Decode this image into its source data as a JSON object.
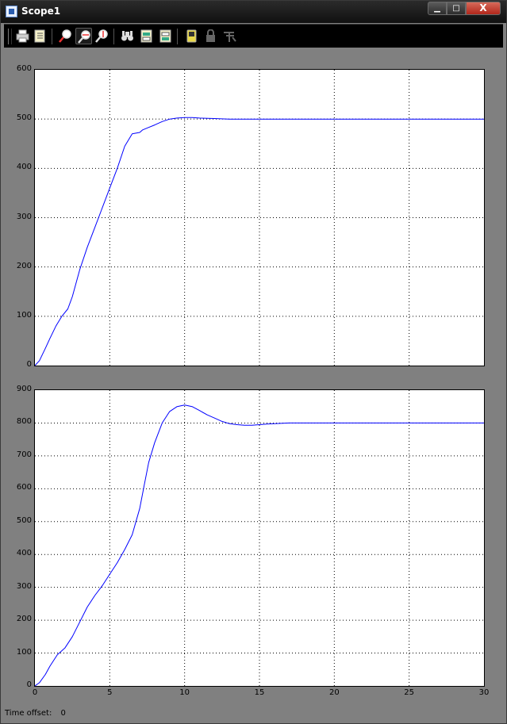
{
  "window": {
    "title": "Scope1",
    "min_label": "▁",
    "max_label": "□",
    "close_label": "X"
  },
  "toolbar": {
    "buttons": [
      {
        "name": "print-icon",
        "active": false
      },
      {
        "name": "parameters-icon",
        "active": false
      },
      {
        "name": "zoom-icon",
        "active": false
      },
      {
        "name": "zoom-x-icon",
        "active": true
      },
      {
        "name": "zoom-y-icon",
        "active": false
      },
      {
        "name": "autoscale-icon",
        "active": false
      },
      {
        "name": "save-axes-settings-icon",
        "active": false
      },
      {
        "name": "restore-axes-settings-icon",
        "active": false
      },
      {
        "name": "floating-scope-icon",
        "active": false
      },
      {
        "name": "lock-axes-icon",
        "active": false
      },
      {
        "name": "signal-selection-icon",
        "active": false
      }
    ]
  },
  "status": {
    "label": "Time offset:",
    "value": "0"
  },
  "chart_data": [
    {
      "type": "line",
      "title": "",
      "xlabel": "",
      "ylabel": "",
      "xlim": [
        0,
        30
      ],
      "ylim": [
        0,
        600
      ],
      "xticks": [
        0,
        5,
        10,
        15,
        20,
        25,
        30
      ],
      "yticks": [
        0,
        100,
        200,
        300,
        400,
        500,
        600
      ],
      "grid": true,
      "series": [
        {
          "color": "#0000ff",
          "x": [
            0,
            0.3,
            0.7,
            1.0,
            1.4,
            1.8,
            2.2,
            2.5,
            3.0,
            3.5,
            4.0,
            4.5,
            5.0,
            5.5,
            6.0,
            6.5,
            7.0,
            7.2,
            7.5,
            8.0,
            8.5,
            9.0,
            9.5,
            10.0,
            10.5,
            11.0,
            12.0,
            13.0,
            30
          ],
          "y": [
            0,
            10,
            35,
            55,
            80,
            100,
            115,
            140,
            195,
            240,
            280,
            320,
            360,
            400,
            445,
            470,
            473,
            478,
            482,
            488,
            495,
            500,
            502,
            503,
            503,
            502,
            501,
            500,
            500
          ]
        }
      ]
    },
    {
      "type": "line",
      "title": "",
      "xlabel": "",
      "ylabel": "",
      "xlim": [
        0,
        30
      ],
      "ylim": [
        0,
        900
      ],
      "xticks": [
        0,
        5,
        10,
        15,
        20,
        25,
        30
      ],
      "yticks": [
        0,
        100,
        200,
        300,
        400,
        500,
        600,
        700,
        800,
        900
      ],
      "grid": true,
      "series": [
        {
          "color": "#0000ff",
          "x": [
            0,
            0.3,
            0.7,
            1.0,
            1.5,
            2.0,
            2.5,
            3.0,
            3.5,
            4.0,
            4.5,
            5.0,
            5.5,
            6.0,
            6.5,
            7.0,
            7.3,
            7.6,
            8.0,
            8.5,
            9.0,
            9.5,
            10.0,
            10.5,
            11.0,
            11.5,
            12.0,
            12.5,
            13.0,
            13.5,
            14.0,
            14.5,
            15.0,
            15.5,
            16.0,
            17.0,
            30
          ],
          "y": [
            0,
            10,
            35,
            60,
            95,
            115,
            150,
            195,
            240,
            275,
            305,
            340,
            375,
            415,
            460,
            540,
            610,
            680,
            740,
            800,
            835,
            850,
            855,
            850,
            838,
            825,
            815,
            805,
            798,
            795,
            793,
            793,
            795,
            797,
            798,
            800,
            800
          ]
        }
      ]
    }
  ]
}
